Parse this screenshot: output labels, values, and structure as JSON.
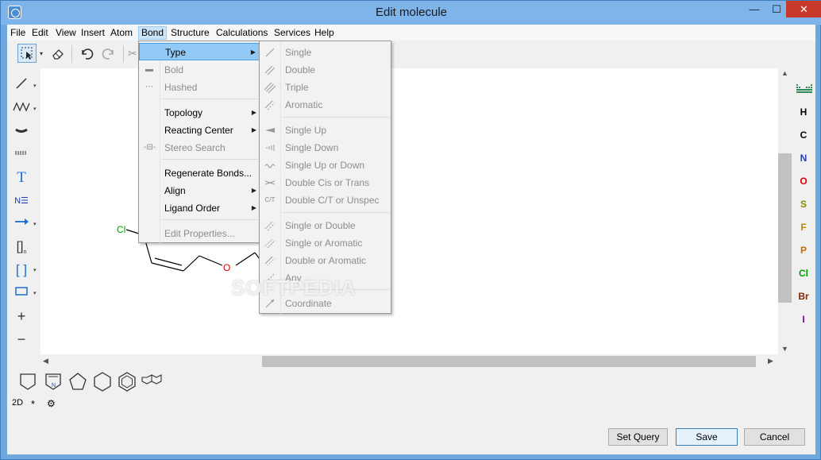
{
  "window": {
    "title": "Edit molecule",
    "min": "—",
    "max": "☐",
    "close": "✕"
  },
  "menubar": [
    "File",
    "Edit",
    "View",
    "Insert",
    "Atom",
    "Bond",
    "Structure",
    "Calculations",
    "Services",
    "Help"
  ],
  "bond_menu": {
    "type": "Type",
    "bold": "Bold",
    "hashed": "Hashed",
    "topology": "Topology",
    "reacting_center": "Reacting Center",
    "stereo_search": "Stereo Search",
    "regenerate": "Regenerate Bonds...",
    "align": "Align",
    "ligand_order": "Ligand Order",
    "edit_properties": "Edit Properties..."
  },
  "type_submenu": {
    "single": "Single",
    "double": "Double",
    "triple": "Triple",
    "aromatic": "Aromatic",
    "single_up": "Single Up",
    "single_down": "Single Down",
    "single_up_or_down": "Single Up or Down",
    "double_cis_trans": "Double Cis or Trans",
    "double_ct_unspec": "Double C/T or Unspec",
    "double_ct_icon": "C/T",
    "single_or_double": "Single or Double",
    "single_or_aromatic": "Single or Aromatic",
    "double_or_aromatic": "Double or Aromatic",
    "any": "Any",
    "coordinate": "Coordinate"
  },
  "canvas": {
    "atom_cl": "Cl",
    "atom_o": "O"
  },
  "elements": [
    {
      "sym": "H",
      "color": "#000000"
    },
    {
      "sym": "C",
      "color": "#000000"
    },
    {
      "sym": "N",
      "color": "#1f3fbf"
    },
    {
      "sym": "O",
      "color": "#e00000"
    },
    {
      "sym": "S",
      "color": "#8a8a00"
    },
    {
      "sym": "F",
      "color": "#b8860b"
    },
    {
      "sym": "P",
      "color": "#c07000"
    },
    {
      "sym": "Cl",
      "color": "#00a000"
    },
    {
      "sym": "Br",
      "color": "#8b2500"
    },
    {
      "sym": "I",
      "color": "#7a0099"
    }
  ],
  "bottom": {
    "mode_2d": "2D",
    "star": "*"
  },
  "buttons": {
    "set_query": "Set Query",
    "save": "Save",
    "cancel": "Cancel"
  },
  "watermark": "SOFTPEDIA"
}
